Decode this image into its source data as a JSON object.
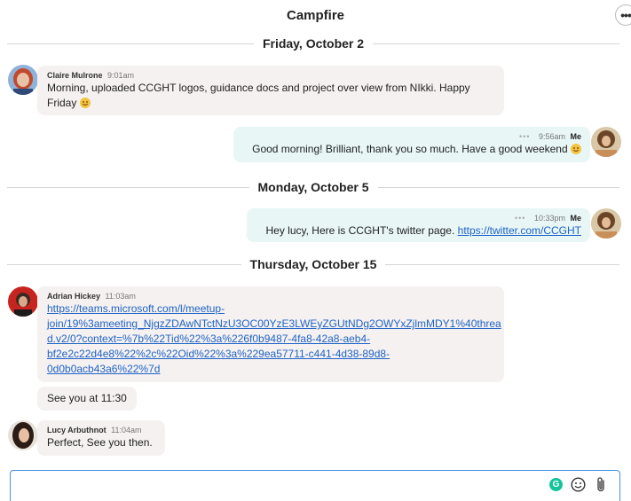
{
  "header": {
    "title": "Campfire",
    "more_label": "•••"
  },
  "dates": [
    "Friday, October 2",
    "Monday, October 5",
    "Thursday, October 15"
  ],
  "messages": [
    {
      "author": "Claire Mulrone",
      "time": "9:01am",
      "text": "Morning, uploaded CCGHT logos, guidance docs and project over view from NIkki. Happy",
      "text2": "Friday"
    },
    {
      "author": "Me",
      "time": "9:56am",
      "text": "Good morning! Brilliant, thank you so much. Have a good weekend"
    },
    {
      "author": "Me",
      "time": "10:33pm",
      "text": "Hey lucy, Here is CCGHT's twitter page.",
      "link": "https://twitter.com/CCGHT"
    },
    {
      "author": "Adrian Hickey",
      "time": "11:03am",
      "link_lines": [
        "https://teams.microsoft.com/l/meetup-",
        "join/19%3ameeting_NjgzZDAwNTctNzU3OC00YzE3LWEyZGUtNDg2OWYxZjlmMDY1%40threa",
        "d.v2/0?context=%7b%22Tid%22%3a%226f0b9487-4fa8-42a8-aeb4-",
        "bf2e2c22d4e8%22%2c%22Oid%22%3a%229ea57711-c441-4d38-89d8-",
        "0d0b0acb43a6%22%7d"
      ],
      "followup": "See you at 11:30"
    },
    {
      "author": "Lucy Arbuthnot",
      "time": "11:04am",
      "text": "Perfect, See you then."
    }
  ],
  "meta": {
    "pending_dots": "•••"
  },
  "composer": {
    "grammarly_label": "G"
  },
  "icons": [
    "more-icon",
    "emoji-icon",
    "grammarly-icon",
    "smiley-icon",
    "paperclip-icon"
  ]
}
